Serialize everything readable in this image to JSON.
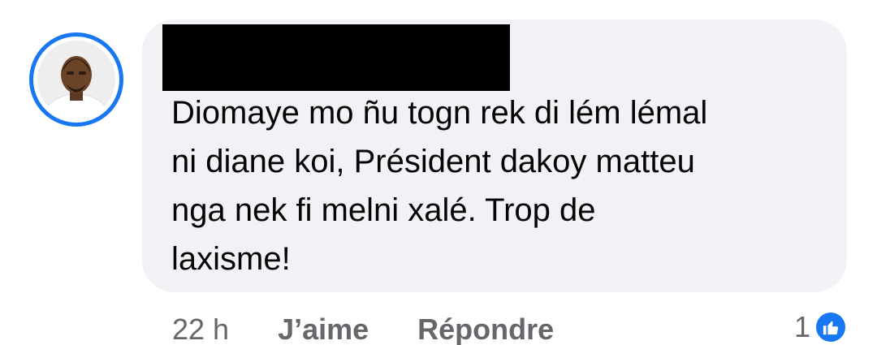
{
  "comment": {
    "author_name_redacted": true,
    "text": "Diomaye mo ñu togn rek di lém lémal\nni diane koi, Président dakoy matteu\nnga nek fi melni xalé. Trop de\nlaxisme!"
  },
  "avatar": {
    "ring_color": "#1877f2",
    "icon": "profile-photo"
  },
  "actions": {
    "timestamp": "22 h",
    "like_label": "J’aime",
    "reply_label": "Répondre"
  },
  "reactions": {
    "count": "1",
    "icon": "thumbs-up-icon",
    "color": "#1877f2"
  }
}
